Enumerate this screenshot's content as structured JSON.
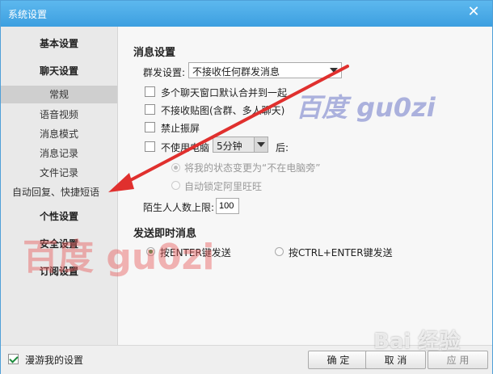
{
  "window": {
    "title": "系统设置"
  },
  "sidebar": {
    "items": [
      {
        "label": "基本设置"
      },
      {
        "label": "聊天设置"
      },
      {
        "label": "常规"
      },
      {
        "label": "语音视频"
      },
      {
        "label": "消息模式"
      },
      {
        "label": "消息记录"
      },
      {
        "label": "文件记录"
      },
      {
        "label": "自动回复、快捷短语"
      },
      {
        "label": "个性设置"
      },
      {
        "label": "安全设置"
      },
      {
        "label": "订阅设置"
      }
    ]
  },
  "message_settings": {
    "title": "消息设置",
    "group_send_label": "群发设置:",
    "group_send_value": "不接收任何群发消息",
    "merge_windows": "多个聊天窗口默认合并到一起",
    "no_sticky": "不接收贴图(含群、多人聊天)",
    "no_shake": "禁止振屏",
    "idle_prefix": "不使用电脑",
    "idle_value": "5分钟",
    "idle_suffix": "后:",
    "idle_option_status": "将我的状态变更为“不在电脑旁”",
    "idle_option_lock": "自动锁定阿里旺旺",
    "stranger_limit_label": "陌生人人数上限:",
    "stranger_limit_value": "100"
  },
  "send_settings": {
    "title": "发送即时消息",
    "enter_send": "按ENTER键发送",
    "ctrl_enter_send": "按CTRL+ENTER键发送"
  },
  "footer": {
    "roaming": "漫游我的设置",
    "ok": "确 定",
    "cancel": "取 消",
    "apply": "应 用"
  },
  "watermarks": {
    "mark1": "百度 gu0zi",
    "mark2": "百度 gu0zi",
    "mark3": "Bai 经验"
  },
  "colors": {
    "titlebar": "#3d9fe0",
    "arrow": "#e0302e",
    "radio_selected": "#2e9b4a"
  }
}
